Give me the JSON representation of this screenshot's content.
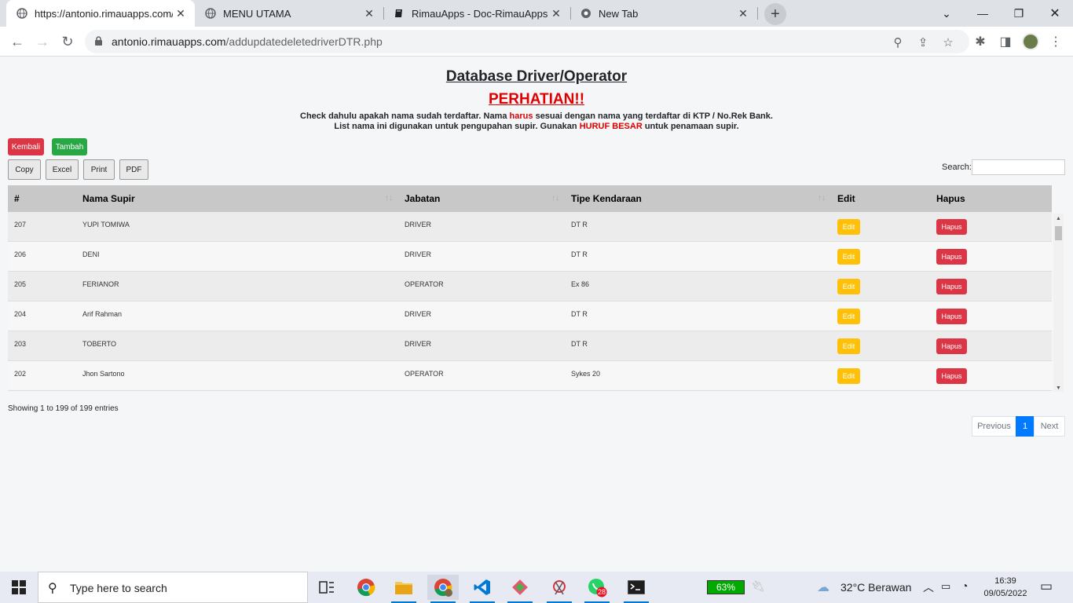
{
  "browser": {
    "tabs": [
      {
        "title": "https://antonio.rimauapps.com/a",
        "active": true,
        "icon": "globe-icon"
      },
      {
        "title": "MENU UTAMA",
        "active": false,
        "icon": "globe-icon"
      },
      {
        "title": "RimauApps - Doc-RimauApps",
        "active": false,
        "icon": "book-icon"
      },
      {
        "title": "New Tab",
        "active": false,
        "icon": "chrome-icon"
      }
    ],
    "url_host": "antonio.rimauapps.com",
    "url_path": "/addupdatedeletedriverDTR.php"
  },
  "page": {
    "title": "Database Driver/Operator",
    "warning": "PERHATIAN!!",
    "notice1_pre": "Check dahulu apakah nama sudah terdaftar. Nama ",
    "notice1_red": "harus",
    "notice1_post": " sesuai dengan nama yang terdaftar di KTP / No.Rek Bank.",
    "notice2_pre": "List nama ini digunakan untuk pengupahan supir. Gunakan ",
    "notice2_red": "HURUF BESAR",
    "notice2_post": " untuk penamaan supir.",
    "btn_back": "Kembali",
    "btn_add": "Tambah",
    "export_buttons": [
      "Copy",
      "Excel",
      "Print",
      "PDF"
    ],
    "search_label": "Search:",
    "search_value": ""
  },
  "table": {
    "headers": [
      "#",
      "Nama Supir",
      "Jabatan",
      "Tipe Kendaraan",
      "Edit",
      "Hapus"
    ],
    "edit_label": "Edit",
    "delete_label": "Hapus",
    "rows": [
      [
        "207",
        "YUPI TOMIWA",
        "DRIVER",
        "DT R"
      ],
      [
        "206",
        "DENI",
        "DRIVER",
        "DT R"
      ],
      [
        "205",
        "FERIANOR",
        "OPERATOR",
        "Ex 86"
      ],
      [
        "204",
        "Arif Rahman",
        "DRIVER",
        "DT R"
      ],
      [
        "203",
        "TOBERTO",
        "DRIVER",
        "DT R"
      ],
      [
        "202",
        "Jhon Sartono",
        "OPERATOR",
        "Sykes 20"
      ]
    ],
    "info": "Showing 1 to 199 of 199 entries",
    "pager": {
      "prev": "Previous",
      "page": "1",
      "next": "Next"
    }
  },
  "taskbar": {
    "search_placeholder": "Type here to search",
    "battery": "63%",
    "weather": "32°C  Berawan",
    "time": "16:39",
    "date": "09/05/2022",
    "whatsapp_badge": "28"
  },
  "colors": {
    "danger": "#dc3545",
    "success": "#28a745",
    "warning": "#ffc107",
    "primary": "#007bff",
    "red_text": "#e00000"
  }
}
